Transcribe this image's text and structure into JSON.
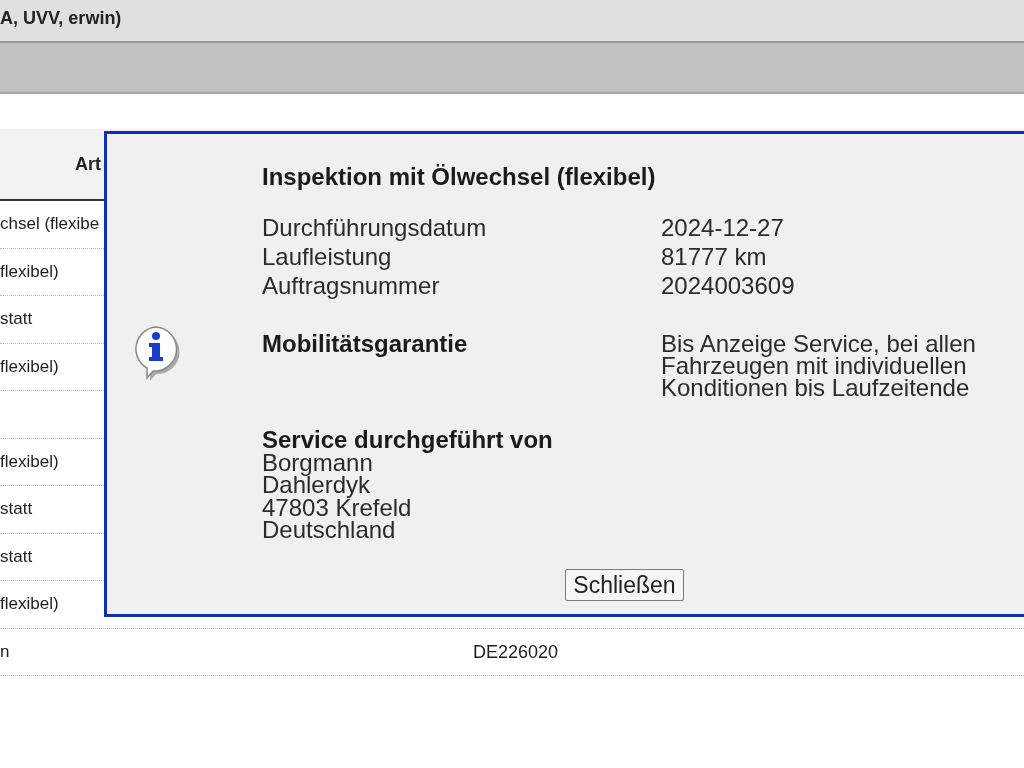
{
  "header": {
    "title": "A, UVV, erwin)"
  },
  "table": {
    "columns": [
      {
        "label": "Art"
      }
    ],
    "rows": [
      {
        "column_1": "chsel (flexibe"
      },
      {
        "column_1": "flexibel)"
      },
      {
        "column_1": "statt"
      },
      {
        "column_1": "flexibel)"
      },
      {},
      {
        "column_1": "flexibel)"
      },
      {
        "column_1": "statt"
      },
      {
        "column_1": "statt"
      },
      {
        "column_1": "flexibel)"
      },
      {
        "column_1": "n",
        "column_2": "DE226020"
      }
    ]
  },
  "dialog": {
    "title": "Inspektion mit Ölwechsel (flexibel)",
    "details": [
      {
        "label": "Durchführungsdatum",
        "value": "2024-12-27"
      },
      {
        "label": "Laufleistung",
        "value": "81777 km"
      },
      {
        "label": "Auftragsnummer",
        "value": "2024003609"
      }
    ],
    "guarantee": {
      "label": "Mobilitätsgarantie",
      "value": "Bis Anzeige Service, bei allen Fahrzeugen mit individuellen Konditionen bis Laufzeitende"
    },
    "service_provider": {
      "heading": "Service durchgeführt von",
      "lines": [
        "Borgmann",
        "Dahlerdyk",
        "47803 Krefeld",
        "Deutschland"
      ]
    },
    "close_button": "Schließen"
  }
}
